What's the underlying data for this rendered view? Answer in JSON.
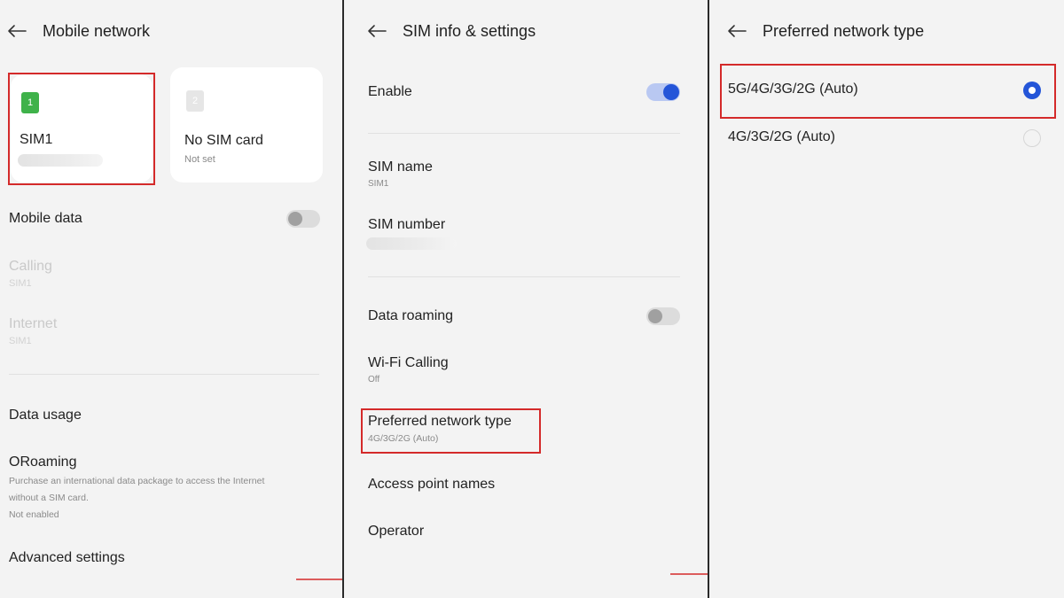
{
  "panel1": {
    "title": "Mobile network",
    "sim1": {
      "slot": "1",
      "label": "SIM1"
    },
    "sim2": {
      "slot": "2",
      "label": "No SIM card",
      "status": "Not set"
    },
    "mobile_data": {
      "label": "Mobile data",
      "enabled": false
    },
    "calling": {
      "label": "Calling",
      "value": "SIM1"
    },
    "internet": {
      "label": "Internet",
      "value": "SIM1"
    },
    "data_usage": {
      "label": "Data usage"
    },
    "oroaming": {
      "label": "ORoaming",
      "desc_line1": "Purchase an international data package to access the Internet",
      "desc_line2": "without a SIM card.",
      "status": "Not enabled"
    },
    "advanced": {
      "label": "Advanced settings"
    }
  },
  "panel2": {
    "title": "SIM info & settings",
    "enable": {
      "label": "Enable",
      "enabled": true
    },
    "sim_name": {
      "label": "SIM name",
      "value": "SIM1"
    },
    "sim_number": {
      "label": "SIM number"
    },
    "data_roaming": {
      "label": "Data roaming",
      "enabled": false
    },
    "wifi_calling": {
      "label": "Wi-Fi Calling",
      "value": "Off"
    },
    "preferred": {
      "label": "Preferred network type",
      "value": "4G/3G/2G (Auto)"
    },
    "apn": {
      "label": "Access point names"
    },
    "operator": {
      "label": "Operator"
    }
  },
  "panel3": {
    "title": "Preferred network type",
    "options": [
      {
        "label": "5G/4G/3G/2G (Auto)",
        "selected": true
      },
      {
        "label": "4G/3G/2G (Auto)",
        "selected": false
      }
    ]
  },
  "colors": {
    "accent": "#2455d8",
    "highlight": "#d42a2a",
    "sim_green": "#3fb24a"
  }
}
